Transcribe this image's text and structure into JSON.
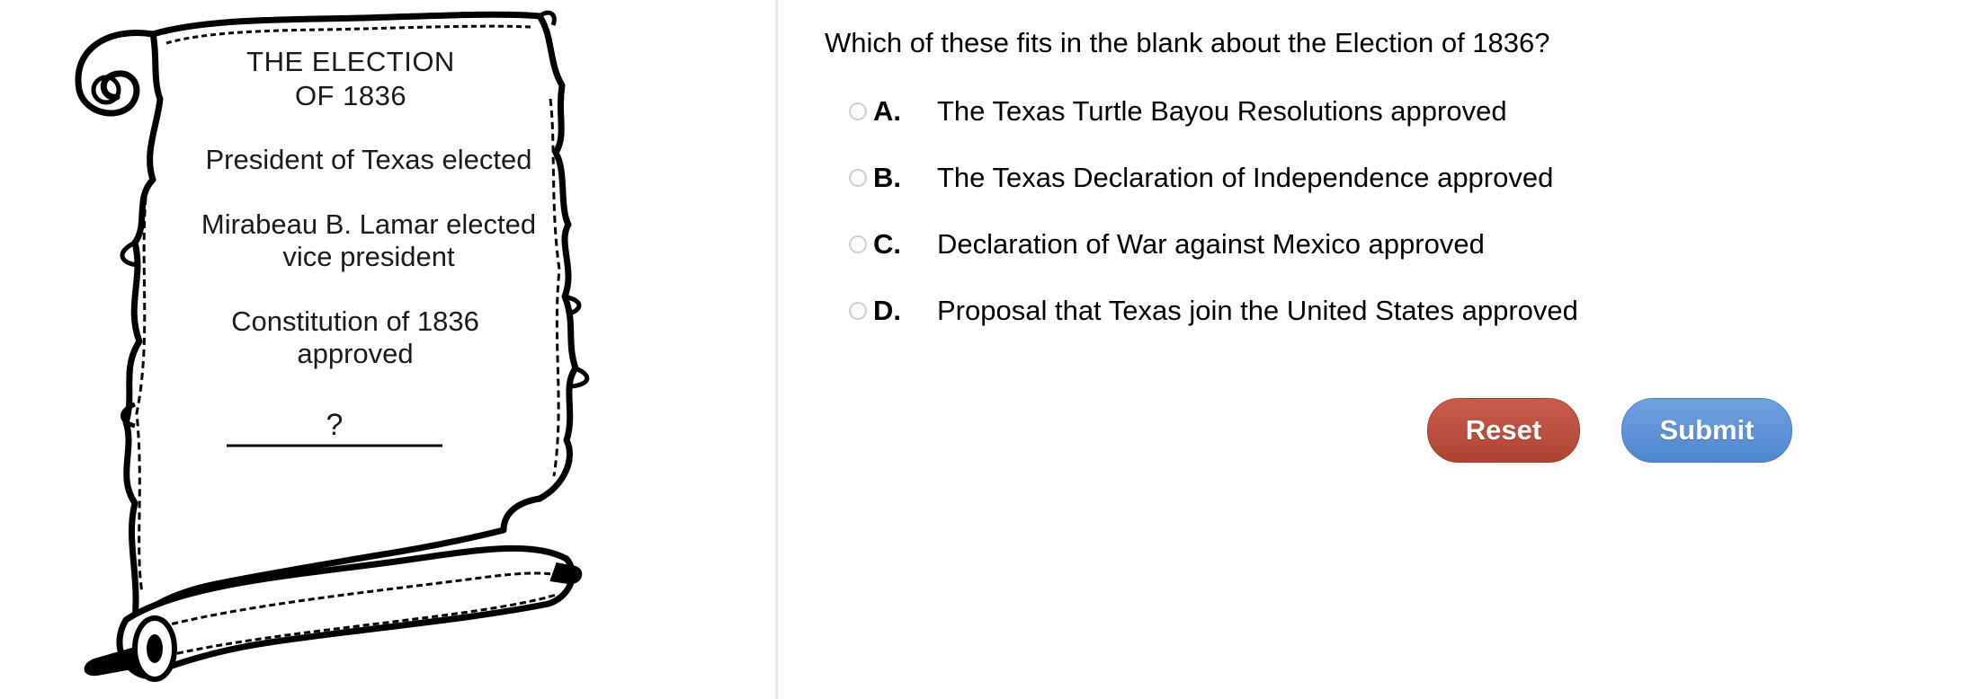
{
  "scroll": {
    "title_line1": "THE ELECTION",
    "title_line2": "OF 1836",
    "line1": "President of Texas elected",
    "line2a": "Mirabeau B. Lamar elected",
    "line2b": "vice president",
    "line3a": "Constitution of 1836",
    "line3b": "approved",
    "blank_mark": "?"
  },
  "question": {
    "text": "Which of these fits in the blank about the Election of 1836?"
  },
  "options": [
    {
      "letter": "A.",
      "text": "The Texas Turtle Bayou Resolutions approved"
    },
    {
      "letter": "B.",
      "text": "The Texas Declaration of Independence approved"
    },
    {
      "letter": "C.",
      "text": "Declaration of War against Mexico approved"
    },
    {
      "letter": "D.",
      "text": "Proposal that Texas join the United States approved"
    }
  ],
  "buttons": {
    "reset_label": "Reset",
    "submit_label": "Submit"
  },
  "colors": {
    "reset": "#b94b39",
    "submit": "#5a8fd6",
    "divider": "#e6e6e6"
  }
}
